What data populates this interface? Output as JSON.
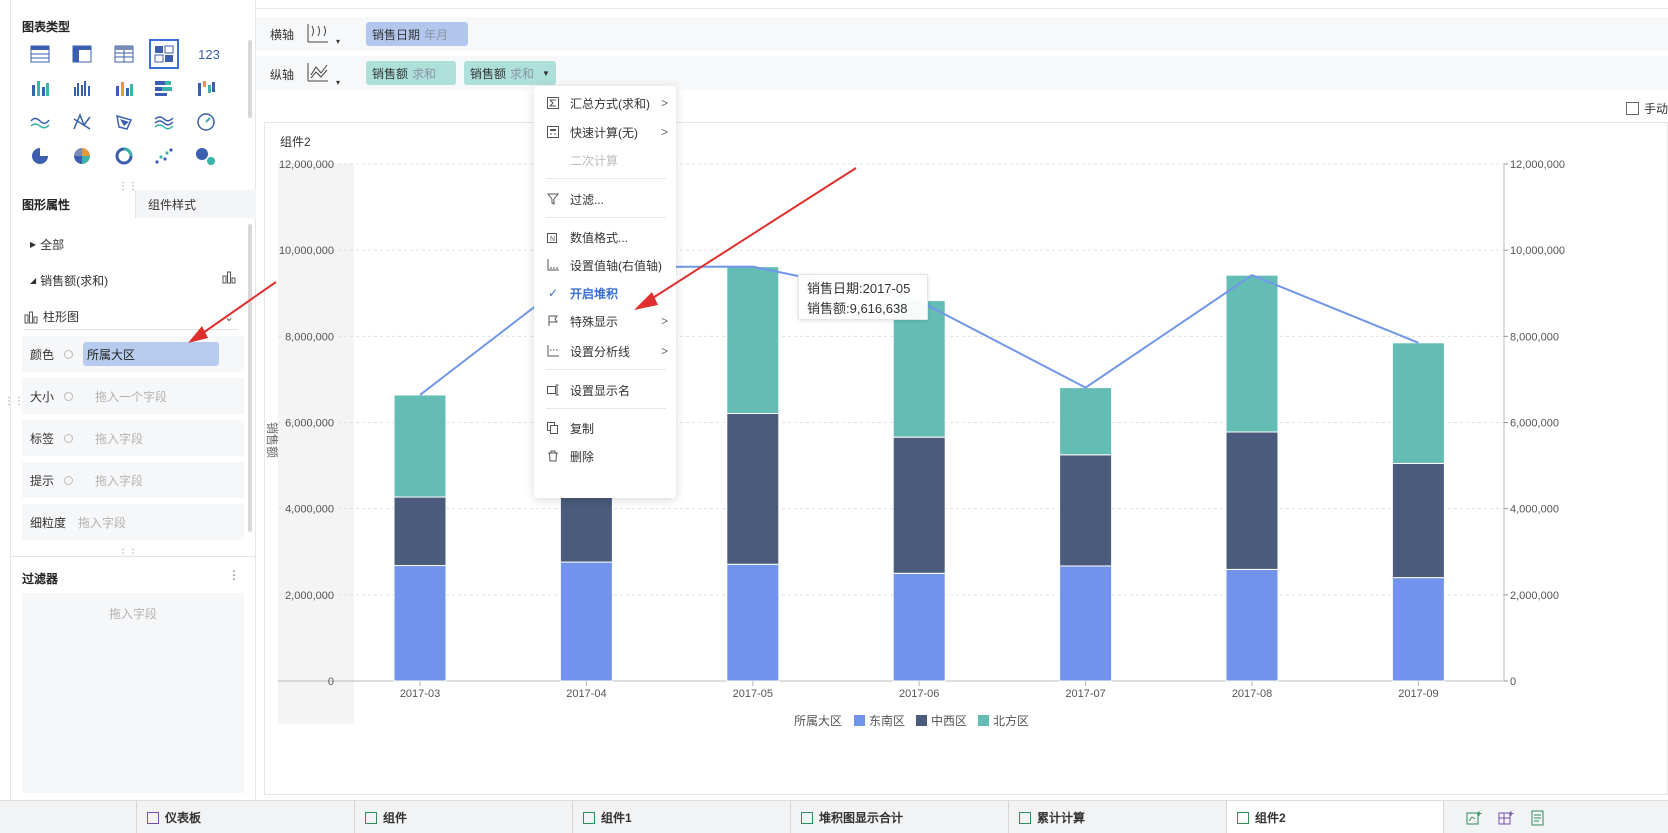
{
  "left_panel": {
    "chart_type_title": "图表类型",
    "chart_type_icons": [
      [
        "table-icon",
        "cross-table-icon",
        "detail-table-icon",
        "combined-table-icon",
        "number-icon"
      ],
      [
        "multi-column-icon",
        "grouped-column-icon",
        "bar-column-icon",
        "stacked-bar-icon",
        "waterfall-icon"
      ],
      [
        "line-icon",
        "radar-icon",
        "map-icon",
        "area-icon",
        "gauge-icon"
      ],
      [
        "pie-icon",
        "rose-icon",
        "ring-icon",
        "scatter-icon",
        "bubble-icon"
      ]
    ],
    "number_icon_text": "123",
    "tabs": {
      "shape_props": "图形属性",
      "component_style": "组件样式"
    },
    "tree": {
      "all": "全部",
      "measure": "销售额(求和)"
    },
    "chart_kind": "柱形图",
    "props": [
      {
        "label": "颜色",
        "value": "所属大区",
        "placeholder": ""
      },
      {
        "label": "大小",
        "value": "",
        "placeholder": "拖入一个字段"
      },
      {
        "label": "标签",
        "value": "",
        "placeholder": "拖入字段"
      },
      {
        "label": "提示",
        "value": "",
        "placeholder": "拖入字段"
      },
      {
        "label": "细粒度",
        "value": "",
        "placeholder": "拖入字段"
      }
    ],
    "filter": {
      "title": "过滤器",
      "placeholder": "拖入字段"
    }
  },
  "axis": {
    "x_label": "横轴",
    "y_label": "纵轴",
    "x_pills": [
      {
        "name": "销售日期",
        "sub": "年月"
      }
    ],
    "y_pills": [
      {
        "name": "销售额",
        "sub": "求和"
      },
      {
        "name": "销售额",
        "sub": "求和"
      }
    ],
    "manual_label": "手动"
  },
  "card": {
    "title": "组件2"
  },
  "menu": {
    "items": [
      {
        "icon": "sigma-icon",
        "label": "汇总方式(求和)",
        "has_sub": true,
        "state": "normal"
      },
      {
        "icon": "calculator-icon",
        "label": "快速计算(无)",
        "has_sub": true,
        "state": "normal"
      },
      {
        "icon": "",
        "label": "二次计算",
        "has_sub": false,
        "state": "disabled"
      },
      {
        "icon": "filter-icon",
        "label": "过滤...",
        "has_sub": false,
        "state": "normal"
      },
      {
        "icon": "number-format-icon",
        "label": "数值格式...",
        "has_sub": false,
        "state": "normal"
      },
      {
        "icon": "axis-icon",
        "label": "设置值轴(右值轴)",
        "has_sub": false,
        "state": "normal"
      },
      {
        "icon": "check-icon",
        "label": "开启堆积",
        "has_sub": false,
        "state": "active"
      },
      {
        "icon": "flag-icon",
        "label": "特殊显示",
        "has_sub": true,
        "state": "normal"
      },
      {
        "icon": "analysis-line-icon",
        "label": "设置分析线",
        "has_sub": true,
        "state": "normal"
      },
      {
        "icon": "rename-icon",
        "label": "设置显示名",
        "has_sub": false,
        "state": "normal"
      },
      {
        "icon": "copy-icon",
        "label": "复制",
        "has_sub": false,
        "state": "normal"
      },
      {
        "icon": "delete-icon",
        "label": "删除",
        "has_sub": false,
        "state": "normal"
      }
    ]
  },
  "tooltip": {
    "line1": "销售日期:2017-05",
    "line2": "销售额:9,616,638"
  },
  "bottom_tabs": [
    {
      "label": "仪表板",
      "icon": "dashboard-icon",
      "active": false
    },
    {
      "label": "组件",
      "icon": "component-icon",
      "active": false
    },
    {
      "label": "组件1",
      "icon": "component-icon",
      "active": false
    },
    {
      "label": "堆积图显示合计",
      "icon": "component-icon",
      "active": false
    },
    {
      "label": "累计计算",
      "icon": "component-icon",
      "active": false
    },
    {
      "label": "组件2",
      "icon": "component-icon",
      "active": true
    }
  ],
  "colors": {
    "southeast": "#7293ec",
    "central_west": "#4b5b7c",
    "north": "#63bdb4",
    "line": "#7296e8",
    "accent": "#3b6fd8",
    "red_arrow": "#e02f2f"
  },
  "chart_data": {
    "type": "bar",
    "stacked": true,
    "categories": [
      "2017-03",
      "2017-04",
      "2017-05",
      "2017-06",
      "2017-07",
      "2017-08",
      "2017-09"
    ],
    "series": [
      {
        "name": "东南区",
        "values": [
          2680000,
          2760000,
          2710000,
          2500000,
          2670000,
          2590000,
          2400000
        ]
      },
      {
        "name": "中西区",
        "values": [
          1590000,
          2050000,
          3500000,
          3160000,
          2580000,
          3190000,
          2650000
        ]
      },
      {
        "name": "北方区",
        "values": [
          2370000,
          4800000,
          3406638,
          3170000,
          1560000,
          3640000,
          2800000
        ]
      }
    ],
    "line_series": {
      "values": [
        6640000,
        9610000,
        9616638,
        8820000,
        6810000,
        9420000,
        7850000
      ]
    },
    "ylim": [
      0,
      12000000
    ],
    "yticks": [
      "0",
      "2,000,000",
      "4,000,000",
      "6,000,000",
      "8,000,000",
      "10,000,000",
      "12,000,000"
    ],
    "ylabel": "销售额",
    "legend_title": "所属大区",
    "legend_position": "bottom-center",
    "grid": true
  }
}
